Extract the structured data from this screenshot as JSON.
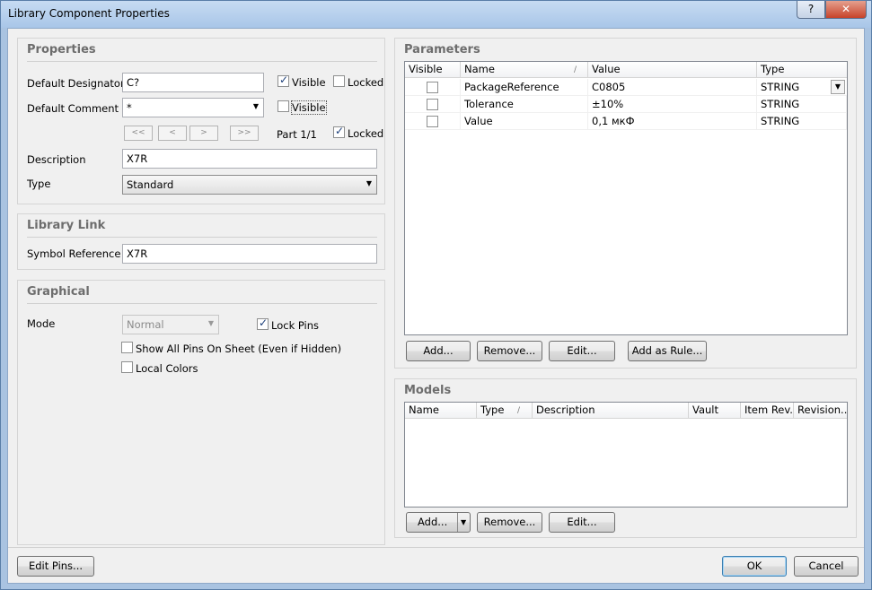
{
  "window": {
    "title": "Library Component Properties",
    "help": "?",
    "close": "✕"
  },
  "properties": {
    "title": "Properties",
    "default_designator_label": "Default Designator",
    "default_designator_value": "C?",
    "visible_label": "Visible",
    "locked_label": "Locked",
    "default_comment_label": "Default Comment",
    "default_comment_value": "*",
    "comment_visible_label": "Visible",
    "nav": [
      "<<",
      "<",
      ">",
      ">>"
    ],
    "part_label": "Part 1/1",
    "part_locked_label": "Locked",
    "description_label": "Description",
    "description_value": "X7R",
    "type_label": "Type",
    "type_value": "Standard",
    "checks": {
      "designator_visible": true,
      "designator_locked": false,
      "comment_visible": false,
      "part_locked": true
    }
  },
  "library_link": {
    "title": "Library Link",
    "symbol_reference_label": "Symbol Reference",
    "symbol_reference_value": "X7R"
  },
  "graphical": {
    "title": "Graphical",
    "mode_label": "Mode",
    "mode_value": "Normal",
    "lock_pins_label": "Lock Pins",
    "show_all_pins_label": "Show All Pins On Sheet (Even if Hidden)",
    "local_colors_label": "Local Colors",
    "checks": {
      "lock_pins": true,
      "show_all_pins": false,
      "local_colors": false
    }
  },
  "parameters": {
    "title": "Parameters",
    "columns": [
      "Visible",
      "Name",
      "Value",
      "Type"
    ],
    "rows": [
      {
        "visible": false,
        "name": "PackageReference",
        "value": "C0805",
        "type": "STRING"
      },
      {
        "visible": false,
        "name": "Tolerance",
        "value": "±10%",
        "type": "STRING"
      },
      {
        "visible": false,
        "name": "Value",
        "value": "0,1 мкФ",
        "type": "STRING"
      }
    ],
    "buttons": {
      "add": "Add...",
      "remove": "Remove...",
      "edit": "Edit...",
      "add_as_rule": "Add as Rule..."
    }
  },
  "models": {
    "title": "Models",
    "columns": [
      "Name",
      "Type",
      "Description",
      "Vault",
      "Item Rev...",
      "Revision..."
    ],
    "buttons": {
      "add": "Add...",
      "remove": "Remove...",
      "edit": "Edit..."
    }
  },
  "footer": {
    "edit_pins": "Edit Pins...",
    "ok": "OK",
    "cancel": "Cancel"
  }
}
